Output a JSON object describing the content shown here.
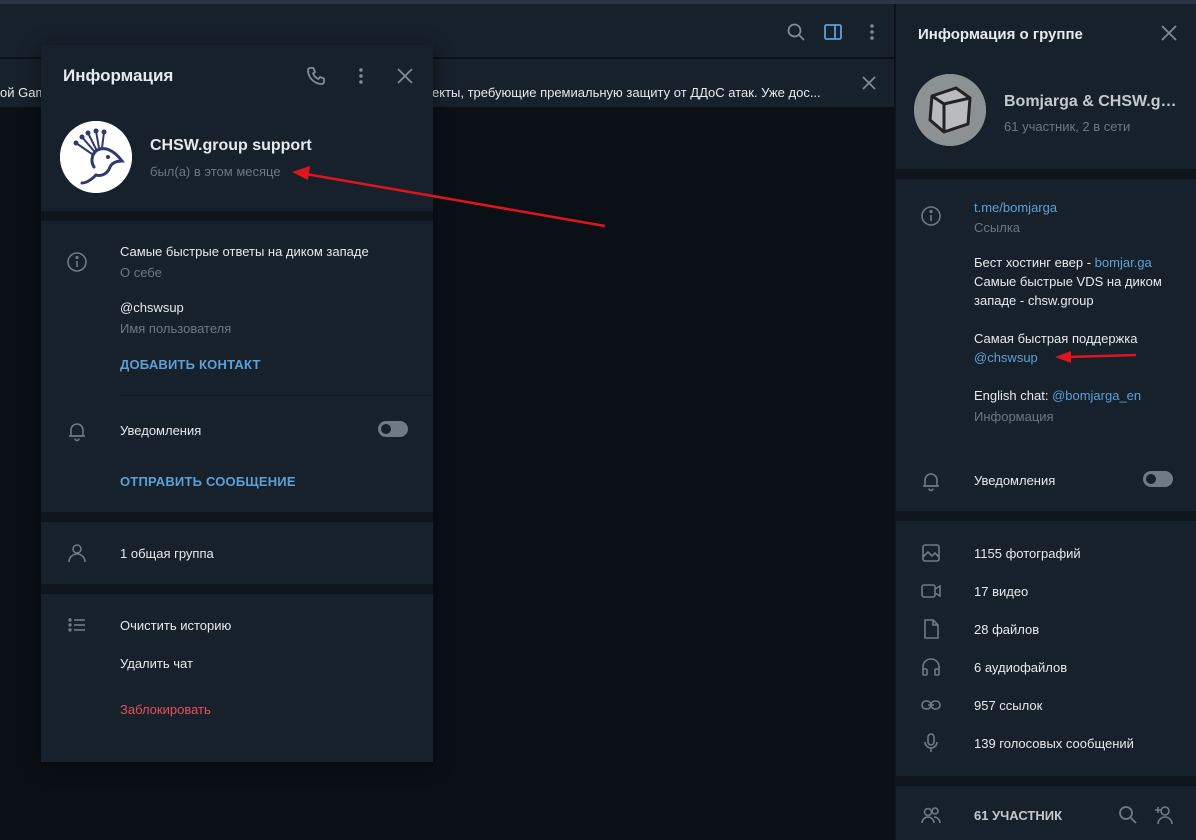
{
  "chat": {
    "pinned_left": "ой Gam",
    "pinned_right": "екты, требующие премиальную защиту от ДДоС атак.  Уже дос..."
  },
  "popup": {
    "title": "Информация",
    "name": "CHSW.group support",
    "status": "был(а) в этом месяце",
    "bio": "Самые быстрые ответы на диком западе",
    "bio_label": "О себе",
    "username": "@chswsup",
    "username_label": "Имя пользователя",
    "add_contact": "ДОБАВИТЬ КОНТАКТ",
    "notifications": "Уведомления",
    "send_message": "ОТПРАВИТЬ СООБЩЕНИЕ",
    "common_groups": "1 общая группа",
    "clear_history": "Очистить историю",
    "delete_chat": "Удалить чат",
    "block": "Заблокировать"
  },
  "group": {
    "title": "Информация о группе",
    "name": "Bomjarga & CHSW.group",
    "members_online": "61 участник, 2 в сети",
    "link": "t.me/bomjarga",
    "link_label": "Ссылка",
    "desc1_prefix": "Бест хостинг евер - ",
    "desc1_link": "bomjar.ga",
    "desc2": "Самые быстрые VDS на диком",
    "desc3": "западе - chsw.group",
    "desc4": "Самая быстрая поддержка",
    "desc4_link": "@chswsup",
    "desc5_prefix": "English chat: ",
    "desc5_link": "@bomjarga_en",
    "desc_label": "Информация",
    "notifications": "Уведомления",
    "media": [
      {
        "icon": "photo-icon",
        "label": "1155 фотографий"
      },
      {
        "icon": "video-icon",
        "label": "17 видео"
      },
      {
        "icon": "file-icon",
        "label": "28 файлов"
      },
      {
        "icon": "headphones-icon",
        "label": "6 аудиофайлов"
      },
      {
        "icon": "link-icon",
        "label": "957 ссылок"
      },
      {
        "icon": "microphone-icon",
        "label": "139 голосовых сообщений"
      }
    ],
    "members_header": "61 УЧАСТНИК"
  },
  "colors": {
    "accent": "#5e9fd6",
    "danger": "#e5505a",
    "arrow": "#e0141c",
    "panel": "#17212b",
    "background": "#0b1017"
  }
}
